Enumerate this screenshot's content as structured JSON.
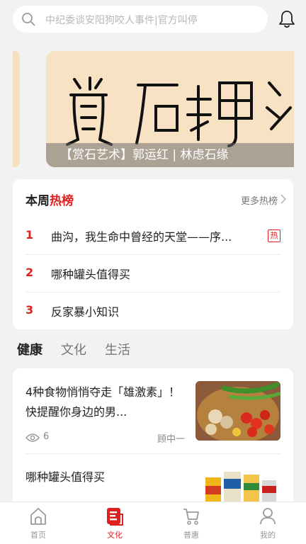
{
  "search": {
    "placeholder": "中纪委谈安阳狗咬人事件|官方叫停"
  },
  "banner": {
    "caption": "【赏石艺术】郭运红 | 林虑石缘",
    "calligraphy": [
      "賞",
      "石",
      "趣",
      "緣"
    ]
  },
  "hot_list": {
    "title_prefix": "本周",
    "title_highlight": "热榜",
    "more_label": "更多热榜",
    "items": [
      {
        "rank": "1",
        "title": "曲沟，我生命中曾经的天堂——序...",
        "tag": "热"
      },
      {
        "rank": "2",
        "title": "哪种罐头值得买",
        "tag": ""
      },
      {
        "rank": "3",
        "title": "反家暴小知识",
        "tag": ""
      }
    ]
  },
  "tabs": [
    {
      "label": "健康",
      "active": true
    },
    {
      "label": "文化",
      "active": false
    },
    {
      "label": "生活",
      "active": false
    }
  ],
  "feed": {
    "articles": [
      {
        "title": "4种食物悄悄夺走「雄激素」！快提醒你身边的男...",
        "views": "6",
        "author": "顾中一"
      },
      {
        "title": "哪种罐头值得买"
      }
    ]
  },
  "nav": {
    "items": [
      {
        "label": "首页",
        "icon": "home-icon"
      },
      {
        "label": "文化",
        "icon": "culture-icon"
      },
      {
        "label": "普惠",
        "icon": "cart-icon"
      },
      {
        "label": "我的",
        "icon": "user-icon"
      }
    ],
    "active_index": 1
  },
  "colors": {
    "accent": "#e02020",
    "background": "#f2f2f2",
    "banner": "#f7e2c4"
  }
}
